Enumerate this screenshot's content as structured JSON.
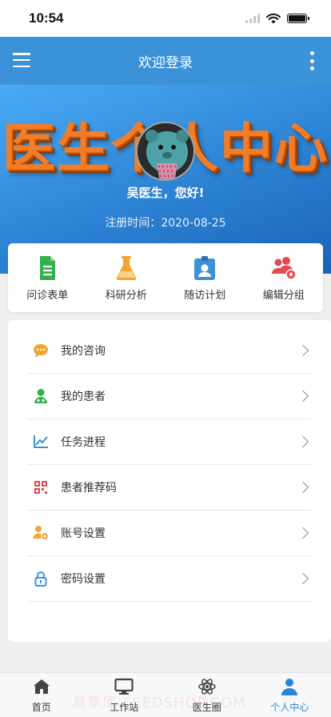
{
  "status_bar": {
    "time": "10:54"
  },
  "header": {
    "title": "欢迎登录"
  },
  "banner": {
    "headline": "医生个人中心",
    "greeting": "吴医生，您好!",
    "register_label": "注册时间：",
    "register_date": "2020-08-25"
  },
  "quick_actions": [
    {
      "label": "问诊表单",
      "icon": "form-doc-icon",
      "color": "#2fb34a"
    },
    {
      "label": "科研分析",
      "icon": "flask-icon",
      "color": "#f2a531"
    },
    {
      "label": "随访计划",
      "icon": "id-badge-icon",
      "color": "#3c92d8"
    },
    {
      "label": "编辑分组",
      "icon": "users-gear-icon",
      "color": "#e5484d"
    }
  ],
  "menu_items": [
    {
      "label": "我的咨询",
      "icon": "chat-bubble-icon",
      "color": "#f2a531"
    },
    {
      "label": "我的患者",
      "icon": "patient-icon",
      "color": "#2fb34a"
    },
    {
      "label": "任务进程",
      "icon": "trend-chart-icon",
      "color": "#3c92d8"
    },
    {
      "label": "患者推荐码",
      "icon": "qr-code-icon",
      "color": "#e5484d"
    },
    {
      "label": "账号设置",
      "icon": "user-gear-icon",
      "color": "#f2a531"
    },
    {
      "label": "密码设置",
      "icon": "lock-icon",
      "color": "#3c92d8"
    }
  ],
  "tabbar": {
    "tabs": [
      {
        "label": "首页",
        "icon": "home-icon"
      },
      {
        "label": "工作站",
        "icon": "monitor-icon"
      },
      {
        "label": "医生圈",
        "icon": "atom-icon"
      },
      {
        "label": "个人中心",
        "icon": "person-icon",
        "active": true
      }
    ],
    "active_color": "#2b84d6"
  },
  "colors": {
    "header_bg": "#3c92d8",
    "banner_title": "#f37d27"
  },
  "watermark": "易享库 FEEDSHOP.COM"
}
